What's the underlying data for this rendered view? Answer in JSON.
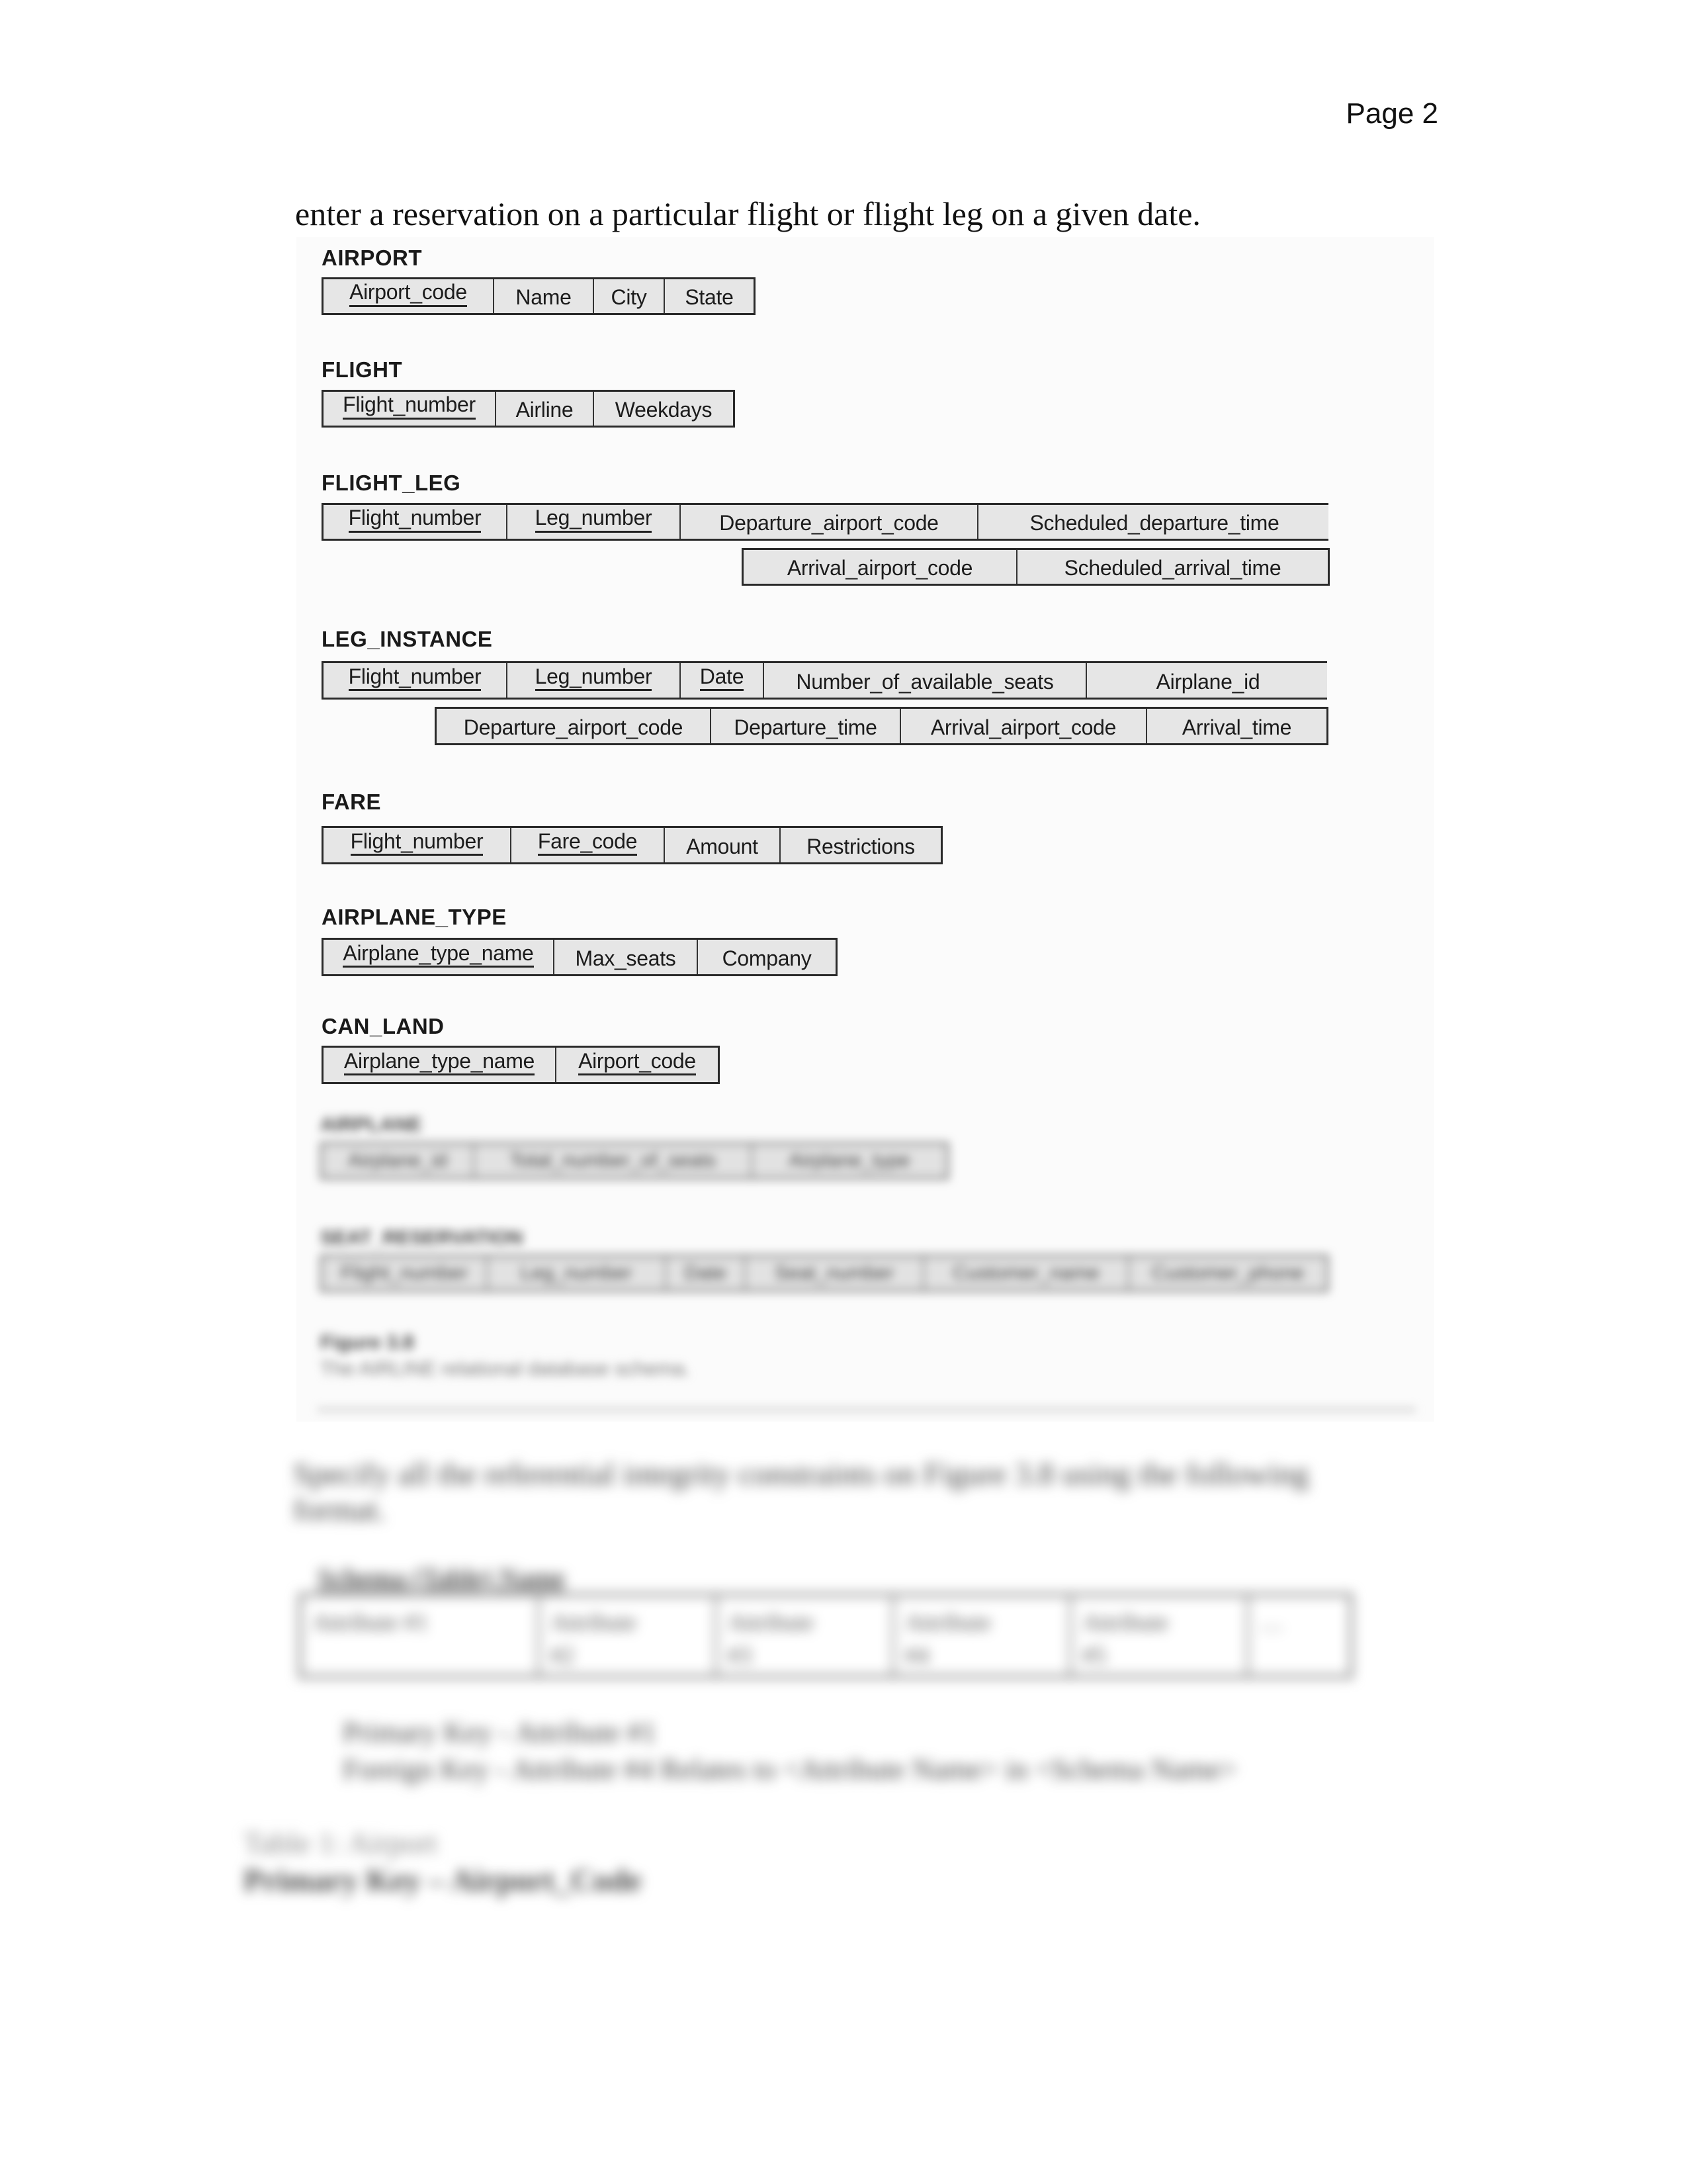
{
  "page": {
    "page_number": "Page 2",
    "intro_text": "enter a reservation on a particular flight or flight leg on a given date."
  },
  "figure": {
    "relations": [
      {
        "name": "AIRPORT",
        "rows": [
          [
            {
              "label": "Airport_code",
              "key": true
            },
            {
              "label": "Name",
              "key": false
            },
            {
              "label": "City",
              "key": false
            },
            {
              "label": "State",
              "key": false
            }
          ]
        ]
      },
      {
        "name": "FLIGHT",
        "rows": [
          [
            {
              "label": "Flight_number",
              "key": true
            },
            {
              "label": "Airline",
              "key": false
            },
            {
              "label": "Weekdays",
              "key": false
            }
          ]
        ]
      },
      {
        "name": "FLIGHT_LEG",
        "rows": [
          [
            {
              "label": "Flight_number",
              "key": true
            },
            {
              "label": "Leg_number",
              "key": true
            },
            {
              "label": "Departure_airport_code",
              "key": false
            },
            {
              "label": "Scheduled_departure_time",
              "key": false
            }
          ],
          [
            {
              "label": "Arrival_airport_code",
              "key": false
            },
            {
              "label": "Scheduled_arrival_time",
              "key": false
            }
          ]
        ]
      },
      {
        "name": "LEG_INSTANCE",
        "rows": [
          [
            {
              "label": "Flight_number",
              "key": true
            },
            {
              "label": "Leg_number",
              "key": true
            },
            {
              "label": "Date",
              "key": true
            },
            {
              "label": "Number_of_available_seats",
              "key": false
            },
            {
              "label": "Airplane_id",
              "key": false
            }
          ],
          [
            {
              "label": "Departure_airport_code",
              "key": false
            },
            {
              "label": "Departure_time",
              "key": false
            },
            {
              "label": "Arrival_airport_code",
              "key": false
            },
            {
              "label": "Arrival_time",
              "key": false
            }
          ]
        ]
      },
      {
        "name": "FARE",
        "rows": [
          [
            {
              "label": "Flight_number",
              "key": true
            },
            {
              "label": "Fare_code",
              "key": true
            },
            {
              "label": "Amount",
              "key": false
            },
            {
              "label": "Restrictions",
              "key": false
            }
          ]
        ]
      },
      {
        "name": "AIRPLANE_TYPE",
        "rows": [
          [
            {
              "label": "Airplane_type_name",
              "key": true
            },
            {
              "label": "Max_seats",
              "key": false
            },
            {
              "label": "Company",
              "key": false
            }
          ]
        ]
      },
      {
        "name": "CAN_LAND",
        "rows": [
          [
            {
              "label": "Airplane_type_name",
              "key": true
            },
            {
              "label": "Airport_code",
              "key": true
            }
          ]
        ]
      }
    ],
    "blurred_relations": [
      {
        "name": "AIRPLANE",
        "cells": [
          "Airplane_id",
          "Total_number_of_seats",
          "Airplane_type"
        ]
      },
      {
        "name": "SEAT_RESERVATION",
        "cells": [
          "Flight_number",
          "Leg_number",
          "Date",
          "Seat_number",
          "Customer_name",
          "Customer_phone"
        ]
      }
    ],
    "caption_title": "Figure 3.8",
    "caption_text": "The AIRLINE relational database schema."
  },
  "instructions": {
    "paragraph_line1": "Specify all the referential integrity constraints on Figure 3.8 using the following",
    "paragraph_line2": "format.",
    "schema_heading": "Schema (Table) Name",
    "schema_cells": [
      {
        "line1": "Attribute #1",
        "line2": ""
      },
      {
        "line1": "Attribute",
        "line2": "#2"
      },
      {
        "line1": "Attribute",
        "line2": "#3"
      },
      {
        "line1": "Attribute",
        "line2": "#4"
      },
      {
        "line1": "Attribute",
        "line2": "#5"
      },
      {
        "line1": "…",
        "line2": ""
      }
    ],
    "primary_key_line": "Primary Key - Attribute #1",
    "foreign_key_line": "Foreign Key - Attribute #4 Relates to <Attribute Name> in <Schema Name>"
  },
  "answer": {
    "table_title": "Table 1: Airport",
    "primary_key": "Primary Key – Airport_Code"
  }
}
